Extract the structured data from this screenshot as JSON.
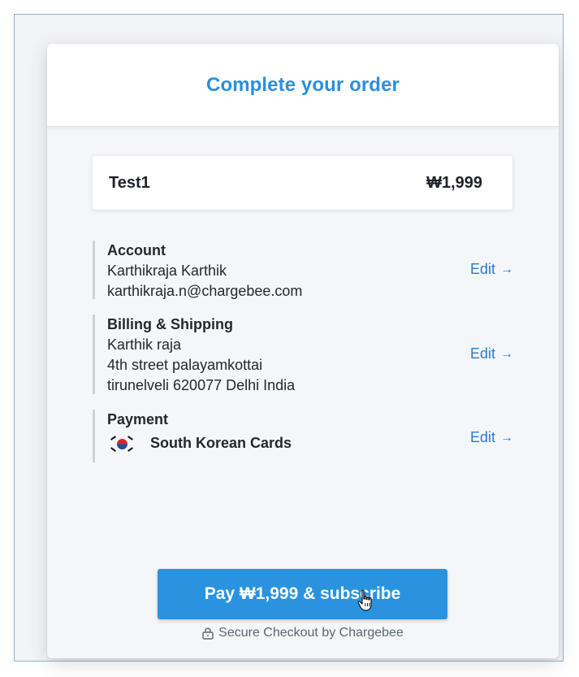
{
  "header": {
    "title": "Complete your order"
  },
  "product": {
    "name": "Test1",
    "price": "₩1,999"
  },
  "account": {
    "title": "Account",
    "name": "Karthikraja Karthik",
    "email": "karthikraja.n@chargebee.com",
    "edit_label": "Edit",
    "arrow": "→"
  },
  "billing": {
    "title": "Billing & Shipping",
    "name": "Karthik raja",
    "line1": "4th street palayamkottai",
    "line2": "tirunelveli 620077 Delhi India",
    "edit_label": "Edit",
    "arrow": "→"
  },
  "payment": {
    "title": "Payment",
    "method": "South Korean Cards",
    "flag_icon": "south-korea-flag-icon",
    "edit_label": "Edit",
    "arrow": "→"
  },
  "pay_button": {
    "label": "Pay ₩1,999 & subscribe"
  },
  "footer": {
    "secure_text": "Secure Checkout by Chargebee",
    "icon": "lock-icon"
  },
  "colors": {
    "accent": "#2a93e0",
    "title": "#2b8fdc",
    "link": "#2b7bc4"
  }
}
